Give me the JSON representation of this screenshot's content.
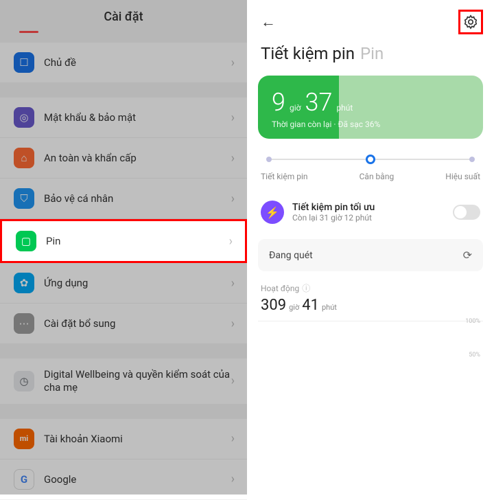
{
  "left": {
    "title": "Cài đặt",
    "items": {
      "theme": "Chủ đề",
      "security": "Mật khẩu & bảo mật",
      "safety": "An toàn và khẩn cấp",
      "privacy": "Bảo vệ cá nhân",
      "battery": "Pin",
      "apps": "Ứng dụng",
      "additional": "Cài đặt bổ sung",
      "wellbeing": "Digital Wellbeing và quyền kiểm soát của cha mẹ",
      "xiaomi": "Tài khoản Xiaomi",
      "google": "Google"
    }
  },
  "right": {
    "title_main": "Tiết kiệm pin",
    "title_sub": "Pin",
    "battery": {
      "hours": "9",
      "hours_u": "giờ",
      "mins": "37",
      "mins_u": "phút",
      "sub": "Thời gian còn lại · Đã sạc 36%"
    },
    "modes": {
      "saver": "Tiết kiệm pin",
      "balanced": "Cân bằng",
      "performance": "Hiệu suất"
    },
    "optimal": {
      "title": "Tiết kiệm pin tối ưu",
      "sub": "Còn lại 31 giờ 12 phút"
    },
    "scan": "Đang quét",
    "activity": {
      "label": "Hoạt động",
      "hours": "309",
      "hours_u": "giờ",
      "mins": "41",
      "mins_u": "phút"
    },
    "chart": {
      "y100": "100%",
      "y50": "50%"
    }
  }
}
